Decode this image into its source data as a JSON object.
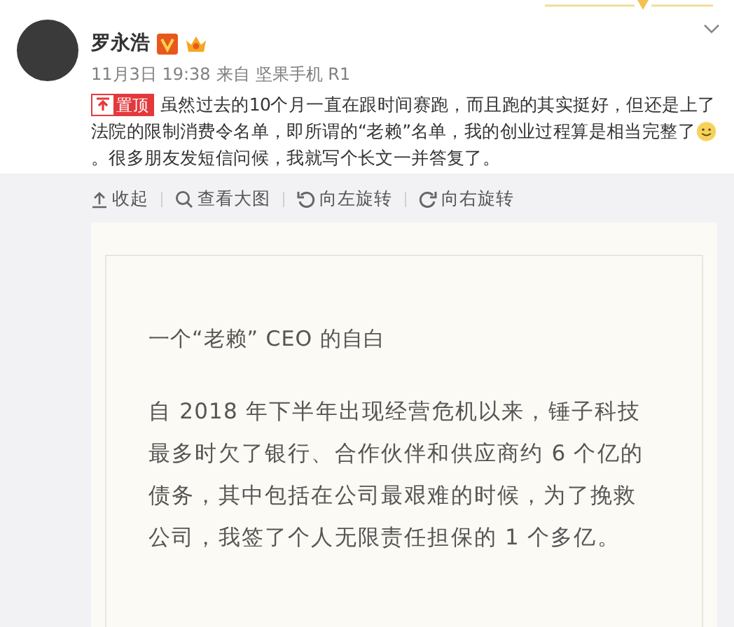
{
  "post": {
    "author": "罗永浩",
    "time": "11月3日 19:38",
    "source_prefix": "来自",
    "source": "坚果手机 R1",
    "pinned_label": "置顶",
    "text_lines": [
      "虽然过去的10个月一直在跟时间赛跑，而且跑的其实挺好，但还是上了",
      "法院的限制消费令名单，即所谓的“老赖”名单，我的创业过程算是相当完整了"
    ],
    "text_after_emoji": "。很多朋友发短信问候，我就写个长文一并答复了。"
  },
  "toolbar": [
    {
      "kind": "collapse",
      "label": "收起"
    },
    {
      "kind": "zoom",
      "label": "查看大图"
    },
    {
      "kind": "rotate_left",
      "label": "向左旋转"
    },
    {
      "kind": "rotate_right",
      "label": "向右旋转"
    }
  ],
  "image": {
    "title": "一个“老赖” CEO 的自白",
    "body_lines": [
      "自 2018 年下半年出现经营危机以来，锤子科技",
      "最多时欠了银行、合作伙伴和供应商约 6 个亿的",
      "债务，其中包括在公司最艰难的时候，为了挽救",
      "公司，我签了个人无限责任担保的 1 个多亿。"
    ]
  }
}
